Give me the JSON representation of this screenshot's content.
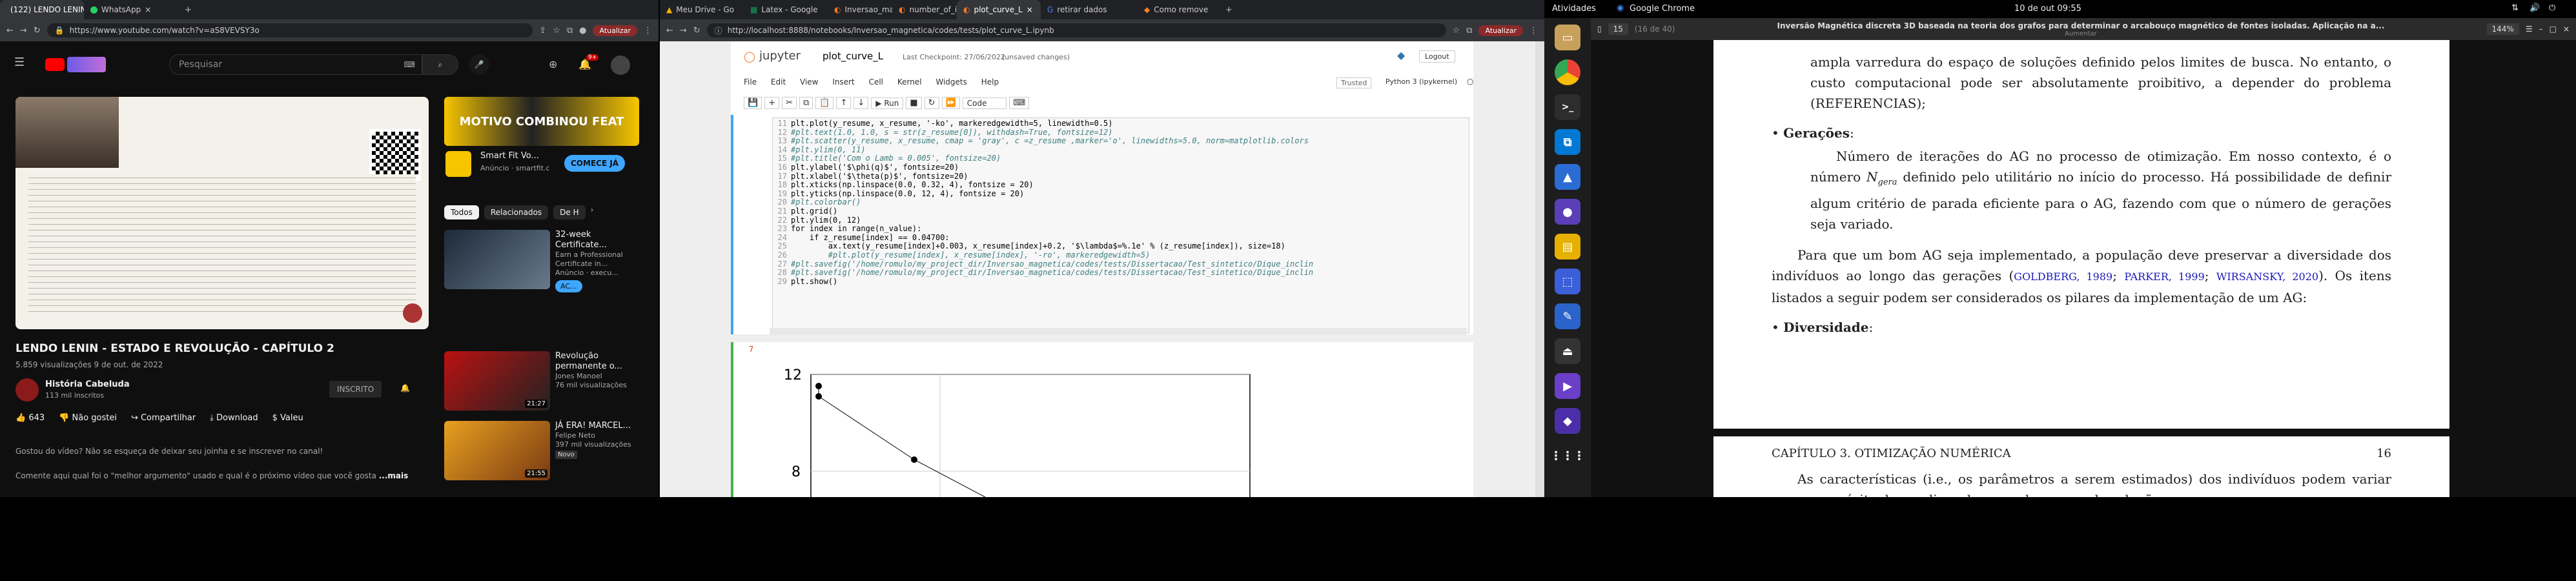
{
  "left_browser": {
    "tabs": [
      {
        "label": "(122) LENDO LENIN"
      },
      {
        "label": "WhatsApp"
      }
    ],
    "url": "https://www.youtube.com/watch?v=aS8VEVSY3o",
    "update_button": "Atualizar",
    "youtube": {
      "search_placeholder": "Pesquisar",
      "notif_badge": "9+",
      "ad_brand": "Smart Fit Vo...",
      "ad_meta": "Anúncio · smartfit.c",
      "ad_cta": "COMECE JÁ",
      "ad_banner": "MOTIVO COMBINOU FEAT",
      "chips": [
        "Todos",
        "Relacionados",
        "De H"
      ],
      "video_title": "LENDO LENIN - ESTADO E REVOLUÇÃO - CAPÍTULO 2",
      "video_stats": "5.859 visualizações  9 de out. de 2022",
      "channel_name": "História Cabeluda",
      "channel_subs": "113 mil inscritos",
      "subscribe": "INSCRITO",
      "likes": "643",
      "dislike": "Não gostei",
      "share": "Compartilhar",
      "download": "Download",
      "thanks": "Valeu",
      "desc_line1": "Gostou do vídeo? Não se esqueça de deixar seu joinha e se inscrever no canal!",
      "desc_line2": "Comente aqui qual foi o \"melhor argumento\" usado e qual é o próximo vídeo que você gosta",
      "more": "...mais",
      "recs": [
        {
          "title": "32-week Certificate...",
          "channel": "Earn a Professional Certificate in...",
          "meta": "Anúncio · execu...",
          "cta": "AC...",
          "duration": ""
        },
        {
          "title": "Revolução permanente o...",
          "channel": "Jones Manoel",
          "meta": "76 mil visualizações",
          "cta": "",
          "duration": "21:27"
        },
        {
          "title": "JÁ ERA! MARCEL...",
          "channel": "Felipe Neto",
          "meta": "397 mil visualizações",
          "cta": "",
          "duration": "21:55",
          "badge": "Novo"
        }
      ]
    }
  },
  "mid_browser": {
    "tabs": [
      "Meu Drive - Go",
      "Latex - Google",
      "Inversao_mag",
      "number_of_i",
      "plot_curve_L",
      "retirar dados",
      "Como remove"
    ],
    "url": "http://localhost:8888/notebooks/Inversao_magnetica/codes/tests/plot_curve_L.ipynb",
    "update_button": "Atualizar",
    "jupyter": {
      "logo": "jupyter",
      "notebook": "plot_curve_L",
      "checkpoint": "Last Checkpoint: 27/06/2022",
      "unsaved": "(unsaved changes)",
      "logout": "Logout",
      "menu": [
        "File",
        "Edit",
        "View",
        "Insert",
        "Cell",
        "Kernel",
        "Widgets",
        "Help"
      ],
      "trusted": "Trusted",
      "kernel": "Python 3 (ipykernel)",
      "run": "Run",
      "cell_type": "Code",
      "code_lines": [
        {
          "n": "11",
          "t": "plt.plot(y_resume, x_resume, '-ko', markeredgewidth=5, linewidth=0.5)",
          "c": "code"
        },
        {
          "n": "12",
          "t": "#plt.text(1.0, 1.0, s = str(z_resume[0]), withdash=True, fontsize=12)",
          "c": "cm"
        },
        {
          "n": "13",
          "t": "#plt.scatter(y_resume, x_resume, cmap = 'gray', c =z_resume ,marker='o', linewidths=5.0, norm=matplotlib.colors",
          "c": "cm"
        },
        {
          "n": "14",
          "t": "#plt.ylim(0, 11)",
          "c": "cm"
        },
        {
          "n": "15",
          "t": "#plt.title('Com o Lamb = 0.005', fontsize=20)",
          "c": "cm"
        },
        {
          "n": "16",
          "t": "plt.ylabel('$\\phi(q)$', fontsize=20)",
          "c": "code"
        },
        {
          "n": "17",
          "t": "plt.xlabel('$\\theta(p)$', fontsize=20)",
          "c": "code"
        },
        {
          "n": "18",
          "t": "plt.xticks(np.linspace(0.0, 0.32, 4), fontsize = 20)",
          "c": "code"
        },
        {
          "n": "19",
          "t": "plt.yticks(np.linspace(0.0, 12, 4), fontsize = 20)",
          "c": "code"
        },
        {
          "n": "20",
          "t": "#plt.colorbar()",
          "c": "cm"
        },
        {
          "n": "21",
          "t": "plt.grid()",
          "c": "code"
        },
        {
          "n": "22",
          "t": "plt.ylim(0, 12)",
          "c": "code"
        },
        {
          "n": "23",
          "t": "for index in range(n_value):",
          "c": "code"
        },
        {
          "n": "24",
          "t": "    if z_resume[index] == 0.04700:",
          "c": "code"
        },
        {
          "n": "25",
          "t": "        ax.text(y_resume[index]+0.003, x_resume[index]+0.2, '$\\lambda$=%.1e' % (z_resume[index]), size=18)",
          "c": "code"
        },
        {
          "n": "26",
          "t": "        #plt.plot(y_resume[index], x_resume[index], '-ro', markeredgewidth=5)",
          "c": "cm"
        },
        {
          "n": "27",
          "t": "#plt.savefig('/home/romulo/my_project_dir/Inversao_magnetica/codes/tests/Dissertacao/Test_sintetico/Dique_inclin",
          "c": "cm"
        },
        {
          "n": "28",
          "t": "#plt.savefig('/home/romulo/my_project_dir/Inversao_magnetica/codes/tests/Dissertacao/Test_sintetico/Dique_inclin",
          "c": "cm"
        },
        {
          "n": "29",
          "t": "plt.show()",
          "c": "code"
        }
      ],
      "out_prompt": "7",
      "plot_ticks": [
        "12",
        "8"
      ]
    }
  },
  "right_desktop": {
    "topbar": {
      "activities": "Atividades",
      "app": "Google Chrome",
      "clock": "10 de out  09:55"
    },
    "pdf": {
      "page_field": "15",
      "page_of": "(16 de 40)",
      "doc_title": "Inversão Magnética discreta 3D baseada na teoria dos grafos para determinar o arcabouço magnético de fontes isoladas. Aplicação na a...",
      "doc_sub": "Aumentar",
      "zoom": "144%",
      "para1": "ampla varredura do espaço de soluções definido pelos limites de busca. No entanto, o custo computacional pode ser absolutamente proibitivo, a depender do problema (REFERENCIAS);",
      "bullet1_title": "Gerações",
      "bullet1_text_a": "Número de iterações do AG no processo de otimização. Em nosso contexto, é o número",
      "bullet1_var": "N",
      "bullet1_sub": "gera",
      "bullet1_text_b": "definido pelo utilitário no início do processo. Há possibilidade de definir algum critério de parada eficiente para o AG, fazendo com que o número de gerações seja variado.",
      "para2_a": "Para que um bom AG seja implementado, a população deve preservar a diversidade dos indivíduos ao longo das gerações (",
      "cites": [
        "GOLDBERG, 1989",
        "PARKER, 1999",
        "WIRSANSKY, 2020"
      ],
      "para2_b": "). Os itens listados a seguir podem ser considerados os pilares da implementação de um AG:",
      "bullet2_title": "Diversidade",
      "chapter": "CAPÍTULO 3.   OTIMIZAÇÃO NUMÉRICA",
      "page_number": "16",
      "para3": "As características (i.e., os parâmetros a serem estimados) dos indivíduos podem variar com o propósito de ampliar a busca pelo espaço de soluções."
    }
  }
}
